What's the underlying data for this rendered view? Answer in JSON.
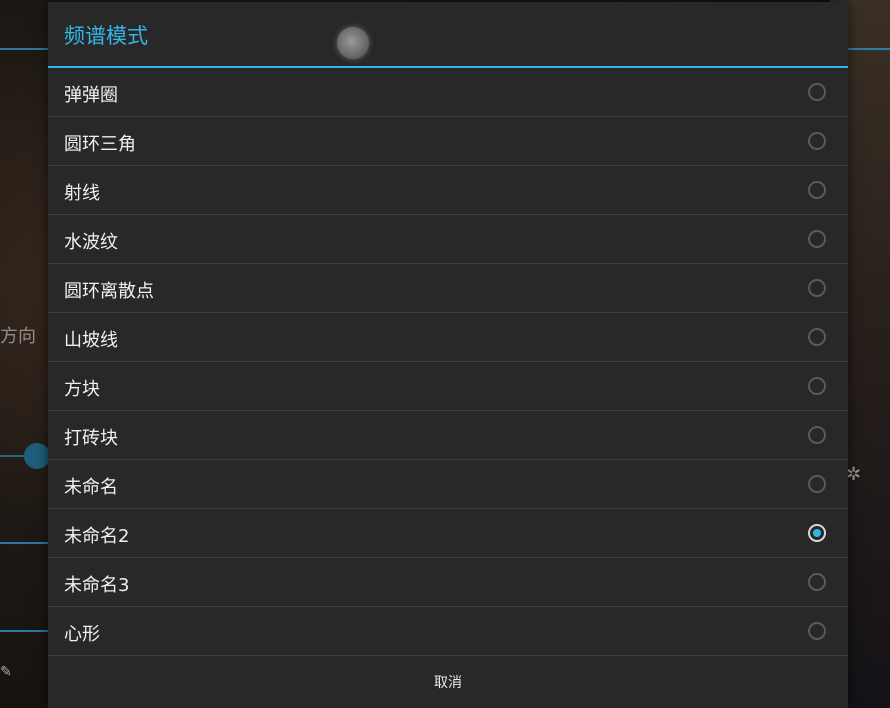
{
  "background": {
    "left_text": "方向",
    "gear_icon": "gear-icon"
  },
  "dialog": {
    "title": "频谱模式",
    "accent_color": "#33b5e5",
    "selected_index": 9,
    "options": [
      {
        "label": "弹弹圈",
        "checked": false
      },
      {
        "label": "圆环三角",
        "checked": false
      },
      {
        "label": "射线",
        "checked": false
      },
      {
        "label": "水波纹",
        "checked": false
      },
      {
        "label": "圆环离散点",
        "checked": false
      },
      {
        "label": "山坡线",
        "checked": false
      },
      {
        "label": "方块",
        "checked": false
      },
      {
        "label": "打砖块",
        "checked": false
      },
      {
        "label": "未命名",
        "checked": false
      },
      {
        "label": "未命名2",
        "checked": true
      },
      {
        "label": "未命名3",
        "checked": false
      },
      {
        "label": "心形",
        "checked": false
      }
    ],
    "cancel_label": "取消"
  }
}
